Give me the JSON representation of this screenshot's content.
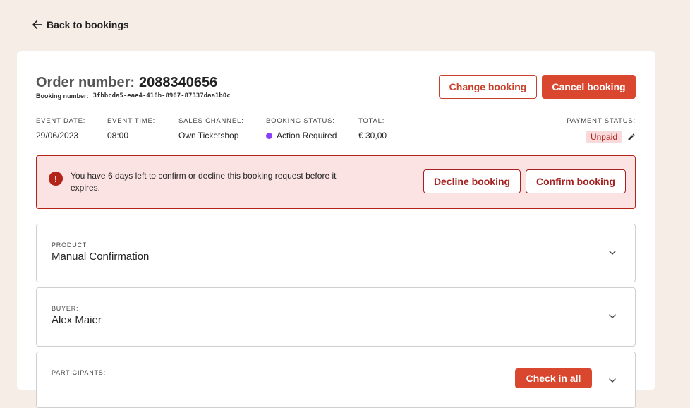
{
  "back": {
    "label": "Back to bookings"
  },
  "order": {
    "label": "Order number:",
    "number": "2088340656",
    "booking_label": "Booking number:",
    "booking_number": "3fbbcda5-eae4-416b-8967-87337daa1b0c"
  },
  "actions": {
    "change": "Change booking",
    "cancel": "Cancel booking"
  },
  "meta": {
    "event_date": {
      "label": "EVENT DATE:",
      "value": "29/06/2023"
    },
    "event_time": {
      "label": "EVENT TIME:",
      "value": "08:00"
    },
    "sales_channel": {
      "label": "SALES CHANNEL:",
      "value": "Own Ticketshop"
    },
    "booking_status": {
      "label": "BOOKING STATUS:",
      "value": "Action Required",
      "color": "#8a3ffc"
    },
    "total": {
      "label": "TOTAL:",
      "value": "€ 30,00"
    },
    "payment_status": {
      "label": "PAYMENT STATUS:",
      "value": "Unpaid"
    }
  },
  "alert": {
    "icon": "exclamation-icon",
    "text": "You have 6 days left to confirm or decline this booking request before it expires.",
    "decline": "Decline booking",
    "confirm": "Confirm booking"
  },
  "panels": {
    "product": {
      "label": "PRODUCT:",
      "value": "Manual Confirmation"
    },
    "buyer": {
      "label": "BUYER:",
      "value": "Alex Maier"
    },
    "participants": {
      "label": "PARTICIPANTS:",
      "checkin": "Check in all"
    }
  },
  "colors": {
    "accent": "#d9472e",
    "danger": "#b42318",
    "background": "#f5ede6"
  }
}
